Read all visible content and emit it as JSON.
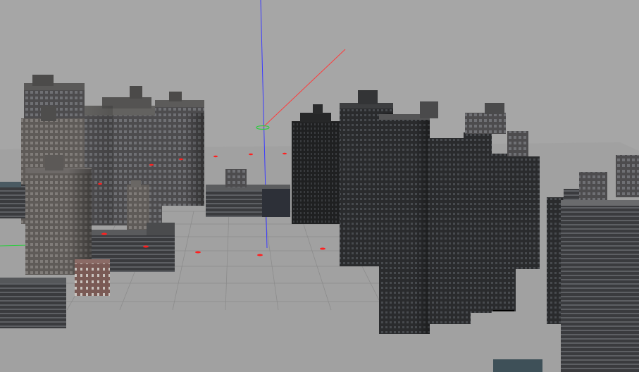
{
  "scene": {
    "colors": {
      "sky": "#a6a6a6",
      "ground": "#a0a0a0",
      "grid": "#8f8f8f",
      "axis_x": "#ff3b3b",
      "axis_y": "#2ecc40",
      "axis_z": "#3b3bff",
      "marker": "#ff2020",
      "facade_dark": "#2b2c2e",
      "facade_mid": "#4a4a4c",
      "facade_light": "#6d6a68",
      "brick": "#7a5a55",
      "roof": "#595857"
    },
    "elements": [
      "city-block-models",
      "ground-grid",
      "axis-gizmo",
      "waypoint-markers"
    ]
  }
}
